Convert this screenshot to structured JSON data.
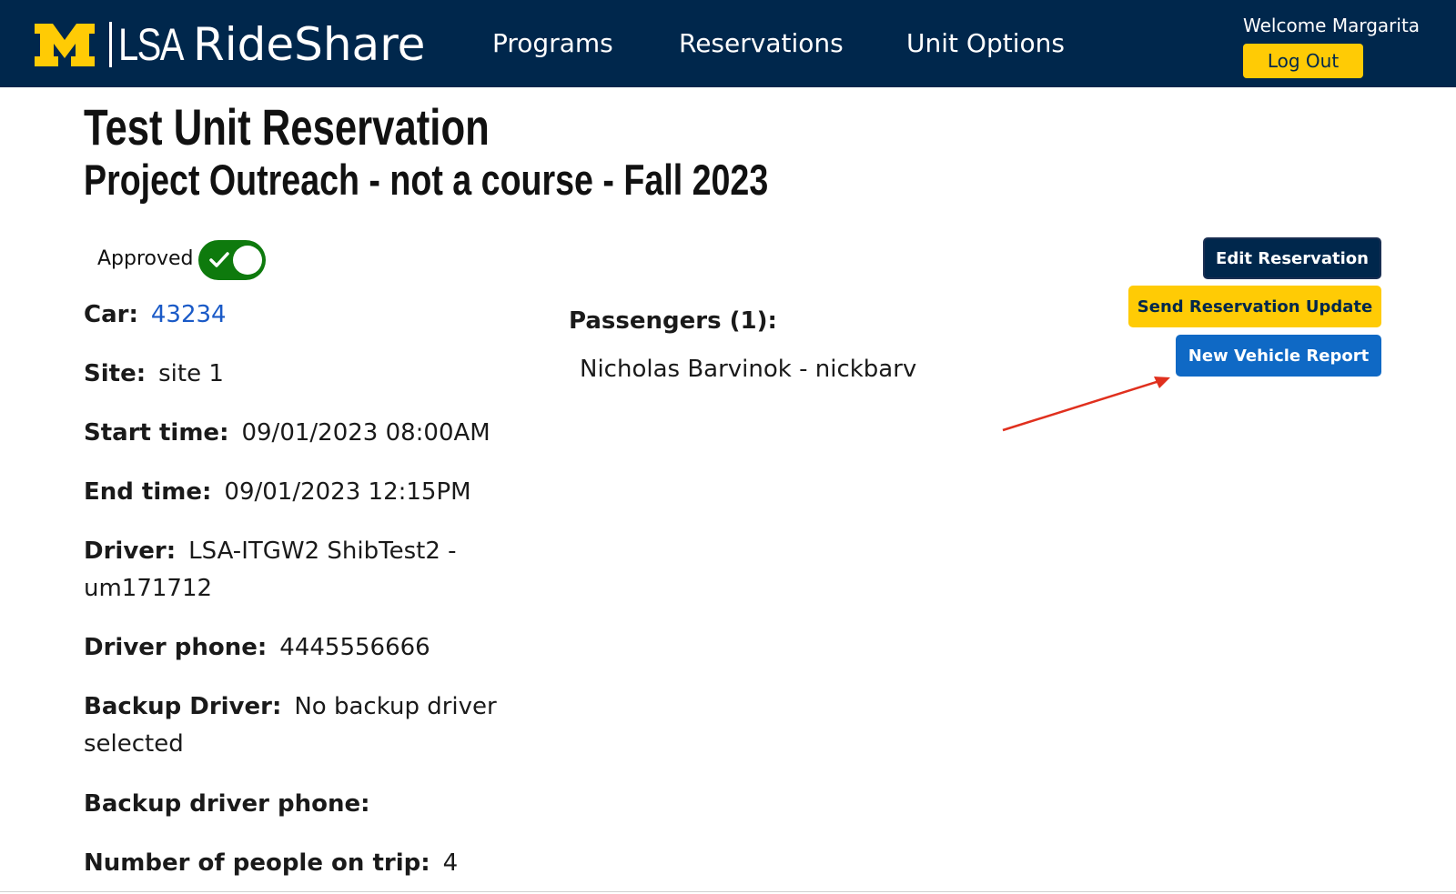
{
  "header": {
    "logo_text": "LSA",
    "app_title": "RideShare",
    "nav": [
      "Programs",
      "Reservations",
      "Unit Options"
    ],
    "welcome": "Welcome Margarita",
    "logout_label": "Log Out"
  },
  "page": {
    "title": "Test Unit Reservation",
    "subtitle": "Project Outreach - not a course - Fall 2023"
  },
  "status": {
    "approved_label": "Approved",
    "approved": true
  },
  "details": {
    "car_label": "Car:",
    "car_value": "43234",
    "site_label": "Site:",
    "site_value": "site 1",
    "start_label": "Start time:",
    "start_value": "09/01/2023 08:00AM",
    "end_label": "End time:",
    "end_value": "09/01/2023 12:15PM",
    "driver_label": "Driver:",
    "driver_value": "LSA-ITGW2 ShibTest2 -",
    "driver_value_2": "um171712",
    "driver_phone_label": "Driver phone:",
    "driver_phone_value": "4445556666",
    "backup_driver_label": "Backup Driver:",
    "backup_driver_value": "No backup driver",
    "backup_driver_value_2": "selected",
    "backup_phone_label": "Backup driver phone:",
    "people_label": "Number of people on trip:",
    "people_value": "4"
  },
  "passengers": {
    "label": "Passengers (1):",
    "items": [
      "Nicholas Barvinok - nickbarv"
    ]
  },
  "actions": {
    "edit_label": "Edit Reservation",
    "send_label": "Send Reservation Update",
    "report_label": "New Vehicle Report"
  },
  "colors": {
    "header_bg": "#00274c",
    "maize": "#ffcb05",
    "report_blue": "#0f69c5",
    "toggle_green": "#0e7a0d",
    "link_blue": "#1a5ac7",
    "arrow_red": "#e0301e"
  }
}
